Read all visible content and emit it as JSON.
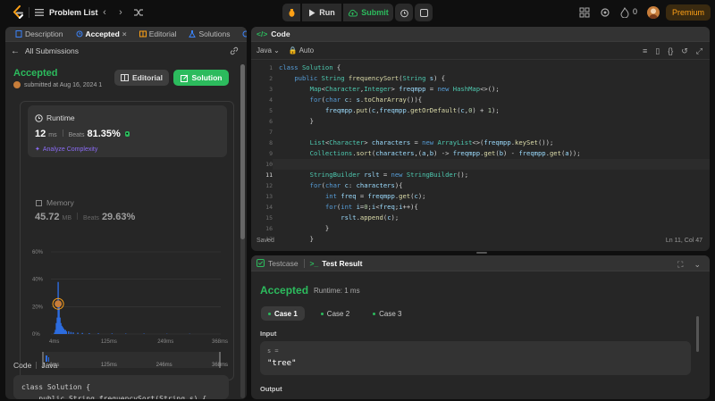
{
  "topbar": {
    "problem_list_label": "Problem List",
    "run_label": "Run",
    "submit_label": "Submit",
    "streak_count": "0",
    "premium_label": "Premium"
  },
  "left": {
    "tabs": [
      "Description",
      "Accepted",
      "Editorial",
      "Solutions",
      "S"
    ],
    "all_submissions_label": "All Submissions",
    "status": "Accepted",
    "submitted_text": "submitted at Aug 16, 2024 1",
    "editorial_button": "Editorial",
    "solution_button": "Solution",
    "runtime": {
      "title": "Runtime",
      "value": "12",
      "unit": "ms",
      "beats_label": "Beats",
      "beats_value": "81.35%",
      "analyze_label": "Analyze Complexity"
    },
    "memory": {
      "title": "Memory",
      "value": "45.72",
      "unit": "MB",
      "beats_label": "Beats",
      "beats_value": "29.63%"
    },
    "code_label": "Code",
    "code_lang": "Java",
    "code_snippet": "class Solution {\n    public String frequencySort(String s) {"
  },
  "chart_data": {
    "type": "bar",
    "y_ticks": [
      "60%",
      "40%",
      "20%",
      "0%"
    ],
    "ylim": [
      0,
      60
    ],
    "x_ticks": [
      "4ms",
      "125ms",
      "249ms",
      "368ms"
    ],
    "range_ticks": [
      "4ms",
      "125ms",
      "246ms",
      "368ms"
    ],
    "x": [
      4,
      6,
      8,
      10,
      12,
      14,
      16,
      18,
      20,
      22,
      24,
      26,
      28,
      30,
      35,
      40,
      45,
      55,
      65,
      80,
      100,
      130,
      160,
      200,
      250,
      300
    ],
    "values": [
      1,
      3,
      8,
      12,
      38,
      22,
      12,
      8,
      6,
      5,
      4,
      3,
      3,
      2,
      2,
      1.5,
      1.2,
      1,
      0.8,
      0.6,
      0.5,
      0.4,
      0.3,
      0.3,
      0.2,
      0.2
    ],
    "highlight_x": 12,
    "color": "#2d6cdf",
    "highlight_color": "#ffa116"
  },
  "editor": {
    "title": "Code",
    "language": "Java",
    "mode": "Auto",
    "line_numbers": [
      "1",
      "2",
      "3",
      "4",
      "5",
      "6",
      "7",
      "8",
      "9",
      "10",
      "11",
      "12",
      "13",
      "14",
      "15",
      "16",
      "17"
    ],
    "lines": [
      [
        [
          "kw",
          "class "
        ],
        [
          "ty",
          "Solution"
        ],
        [
          "pl",
          " {"
        ]
      ],
      [
        [
          "pl",
          "    "
        ],
        [
          "kw",
          "public "
        ],
        [
          "ty",
          "String "
        ],
        [
          "fn",
          "frequencySort"
        ],
        [
          "pl",
          "("
        ],
        [
          "ty",
          "String "
        ],
        [
          "va",
          "s"
        ],
        [
          "pl",
          ") {"
        ]
      ],
      [
        [
          "pl",
          "        "
        ],
        [
          "ty",
          "Map"
        ],
        [
          "pl",
          "<"
        ],
        [
          "ty",
          "Character"
        ],
        [
          "pl",
          ","
        ],
        [
          "ty",
          "Integer"
        ],
        [
          "pl",
          "> "
        ],
        [
          "va",
          "freqmpp"
        ],
        [
          "pl",
          " = "
        ],
        [
          "kw",
          "new "
        ],
        [
          "ty",
          "HashMap"
        ],
        [
          "pl",
          "<>();"
        ]
      ],
      [
        [
          "pl",
          "        "
        ],
        [
          "kw",
          "for"
        ],
        [
          "pl",
          "("
        ],
        [
          "kw",
          "char "
        ],
        [
          "va",
          "c"
        ],
        [
          "pl",
          ": "
        ],
        [
          "va",
          "s"
        ],
        [
          "pl",
          "."
        ],
        [
          "fn",
          "toCharArray"
        ],
        [
          "pl",
          "()){"
        ]
      ],
      [
        [
          "pl",
          "            "
        ],
        [
          "va",
          "freqmpp"
        ],
        [
          "pl",
          "."
        ],
        [
          "fn",
          "put"
        ],
        [
          "pl",
          "("
        ],
        [
          "va",
          "c"
        ],
        [
          "pl",
          ","
        ],
        [
          "va",
          "freqmpp"
        ],
        [
          "pl",
          "."
        ],
        [
          "fn",
          "getOrDefault"
        ],
        [
          "pl",
          "("
        ],
        [
          "va",
          "c"
        ],
        [
          "pl",
          ","
        ],
        [
          "nm",
          "0"
        ],
        [
          "pl",
          ") + "
        ],
        [
          "nm",
          "1"
        ],
        [
          "pl",
          ");"
        ]
      ],
      [
        [
          "pl",
          "        }"
        ]
      ],
      [
        [
          "pl",
          ""
        ]
      ],
      [
        [
          "pl",
          "        "
        ],
        [
          "ty",
          "List"
        ],
        [
          "pl",
          "<"
        ],
        [
          "ty",
          "Character"
        ],
        [
          "pl",
          "> "
        ],
        [
          "va",
          "characters"
        ],
        [
          "pl",
          " = "
        ],
        [
          "kw",
          "new "
        ],
        [
          "ty",
          "ArrayList"
        ],
        [
          "pl",
          "<>("
        ],
        [
          "va",
          "freqmpp"
        ],
        [
          "pl",
          "."
        ],
        [
          "fn",
          "keySet"
        ],
        [
          "pl",
          "());"
        ]
      ],
      [
        [
          "pl",
          "        "
        ],
        [
          "ty",
          "Collections"
        ],
        [
          "pl",
          "."
        ],
        [
          "fn",
          "sort"
        ],
        [
          "pl",
          "("
        ],
        [
          "va",
          "characters"
        ],
        [
          "pl",
          ",("
        ],
        [
          "va",
          "a"
        ],
        [
          "pl",
          ","
        ],
        [
          "va",
          "b"
        ],
        [
          "pl",
          ") -> "
        ],
        [
          "va",
          "freqmpp"
        ],
        [
          "pl",
          "."
        ],
        [
          "fn",
          "get"
        ],
        [
          "pl",
          "("
        ],
        [
          "va",
          "b"
        ],
        [
          "pl",
          ") - "
        ],
        [
          "va",
          "freqmpp"
        ],
        [
          "pl",
          "."
        ],
        [
          "fn",
          "get"
        ],
        [
          "pl",
          "("
        ],
        [
          "va",
          "a"
        ],
        [
          "pl",
          "));"
        ]
      ],
      [
        [
          "pl",
          ""
        ]
      ],
      [
        [
          "pl",
          "        "
        ],
        [
          "ty",
          "StringBuilder "
        ],
        [
          "va",
          "rslt"
        ],
        [
          "pl",
          " = "
        ],
        [
          "kw",
          "new "
        ],
        [
          "ty",
          "StringBuilder"
        ],
        [
          "pl",
          "();"
        ]
      ],
      [
        [
          "pl",
          "        "
        ],
        [
          "kw",
          "for"
        ],
        [
          "pl",
          "("
        ],
        [
          "kw",
          "char "
        ],
        [
          "va",
          "c"
        ],
        [
          "pl",
          ": "
        ],
        [
          "va",
          "characters"
        ],
        [
          "pl",
          "){"
        ]
      ],
      [
        [
          "pl",
          "            "
        ],
        [
          "kw",
          "int "
        ],
        [
          "va",
          "freq"
        ],
        [
          "pl",
          " = "
        ],
        [
          "va",
          "freqmpp"
        ],
        [
          "pl",
          "."
        ],
        [
          "fn",
          "get"
        ],
        [
          "pl",
          "("
        ],
        [
          "va",
          "c"
        ],
        [
          "pl",
          ");"
        ]
      ],
      [
        [
          "pl",
          "            "
        ],
        [
          "kw",
          "for"
        ],
        [
          "pl",
          "("
        ],
        [
          "kw",
          "int "
        ],
        [
          "va",
          "i"
        ],
        [
          "pl",
          "="
        ],
        [
          "nm",
          "0"
        ],
        [
          "pl",
          ";"
        ],
        [
          "va",
          "i"
        ],
        [
          "pl",
          "<"
        ],
        [
          "va",
          "freq"
        ],
        [
          "pl",
          ";"
        ],
        [
          "va",
          "i"
        ],
        [
          "pl",
          "++){"
        ]
      ],
      [
        [
          "pl",
          "                "
        ],
        [
          "va",
          "rslt"
        ],
        [
          "pl",
          "."
        ],
        [
          "fn",
          "append"
        ],
        [
          "pl",
          "("
        ],
        [
          "va",
          "c"
        ],
        [
          "pl",
          ");"
        ]
      ],
      [
        [
          "pl",
          "            }"
        ]
      ],
      [
        [
          "pl",
          "        }"
        ]
      ]
    ],
    "saved_label": "Saved",
    "cursor_pos": "Ln 11, Col 47"
  },
  "test": {
    "testcase_tab": "Testcase",
    "result_tab": "Test Result",
    "status": "Accepted",
    "runtime_text": "Runtime: 1 ms",
    "cases": [
      "Case 1",
      "Case 2",
      "Case 3"
    ],
    "input_label": "Input",
    "input_name": "s =",
    "input_value": "\"tree\"",
    "output_label": "Output"
  }
}
